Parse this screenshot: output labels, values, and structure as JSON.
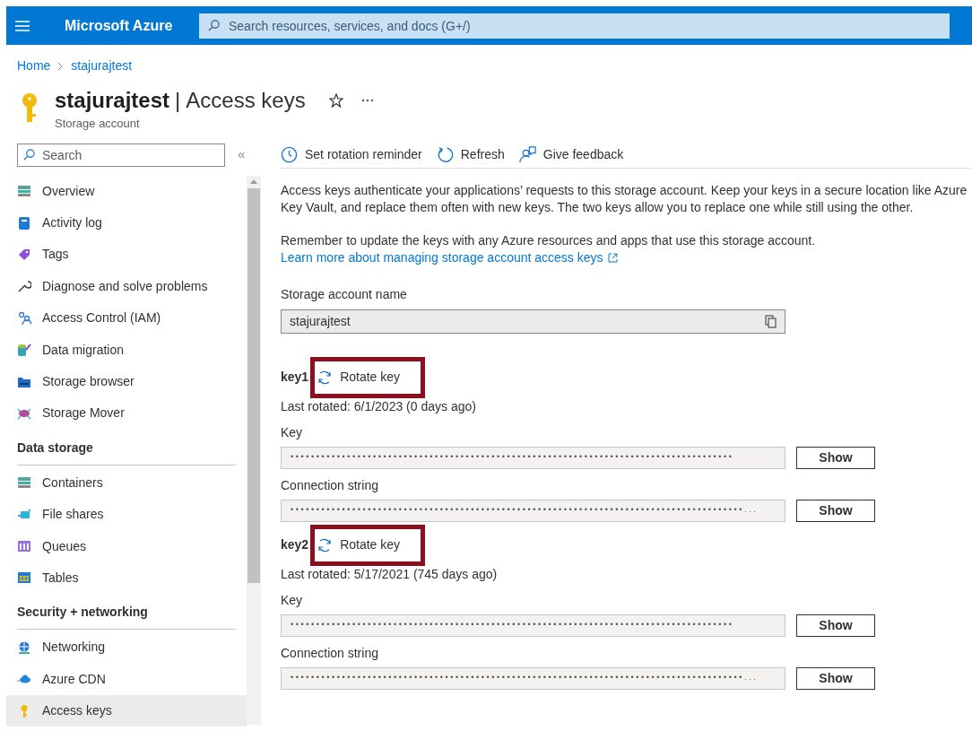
{
  "topbar": {
    "brand": "Microsoft Azure",
    "search": {
      "placeholder": "Search resources, services, and docs (G+/)"
    }
  },
  "breadcrumb": [
    "Home",
    "stajurajtest"
  ],
  "header": {
    "resource": "stajurajtest",
    "separator": "|",
    "page": "Access keys",
    "subtitle": "Storage account"
  },
  "sidebar": {
    "search": {
      "placeholder": "Search"
    },
    "collapse": "«",
    "groups": [
      {
        "items": [
          {
            "label": "Overview",
            "selected": false
          },
          {
            "label": "Activity log",
            "selected": false
          },
          {
            "label": "Tags",
            "selected": false
          },
          {
            "label": "Diagnose and solve problems",
            "selected": false
          },
          {
            "label": "Access Control (IAM)",
            "selected": false
          },
          {
            "label": "Data migration",
            "selected": false
          },
          {
            "label": "Storage browser",
            "selected": false
          },
          {
            "label": "Storage Mover",
            "selected": false
          }
        ]
      },
      {
        "heading": "Data storage",
        "items": [
          {
            "label": "Containers",
            "selected": false
          },
          {
            "label": "File shares",
            "selected": false
          },
          {
            "label": "Queues",
            "selected": false
          },
          {
            "label": "Tables",
            "selected": false
          }
        ]
      },
      {
        "heading": "Security + networking",
        "items": [
          {
            "label": "Networking",
            "selected": false
          },
          {
            "label": "Azure CDN",
            "selected": false
          },
          {
            "label": "Access keys",
            "selected": true
          }
        ]
      }
    ]
  },
  "toolbar": [
    "Set rotation reminder",
    "Refresh",
    "Give feedback"
  ],
  "intro": "Access keys authenticate your applications’ requests to this storage account. Keep your keys in a secure location like Azure Key Vault, and replace them often with new keys. The two keys allow you to replace one while still using the other.",
  "reminder": "Remember to update the keys with any Azure resources and apps that use this storage account.",
  "learn_more": "Learn more about managing storage account access keys",
  "account_name": {
    "label": "Storage account name",
    "value": "stajurajtest"
  },
  "keys": [
    {
      "name": "key1",
      "rotate": "Rotate key",
      "highlighted": true,
      "last_rotated": "Last rotated: 6/1/2023 (0 days ago)",
      "fields": [
        {
          "label": "Key",
          "value": "••••••••••••••••••••••••••••••••••••••••••••••••••••••••••••••••••••••••••••••••••••••",
          "button": "Show"
        },
        {
          "label": "Connection string",
          "value": "••••••••••••••••••••••••••••••••••••••••••••••••••••••••••••••••••••••••••••••••••••••••...",
          "button": "Show"
        }
      ]
    },
    {
      "name": "key2",
      "rotate": "Rotate key",
      "highlighted": true,
      "last_rotated": "Last rotated: 5/17/2021 (745 days ago)",
      "fields": [
        {
          "label": "Key",
          "value": "••••••••••••••••••••••••••••••••••••••••••••••••••••••••••••••••••••••••••••••••••••••",
          "button": "Show"
        },
        {
          "label": "Connection string",
          "value": "••••••••••••••••••••••••••••••••••••••••••••••••••••••••••••••••••••••••••••••••••••••••...",
          "button": "Show"
        }
      ]
    }
  ]
}
